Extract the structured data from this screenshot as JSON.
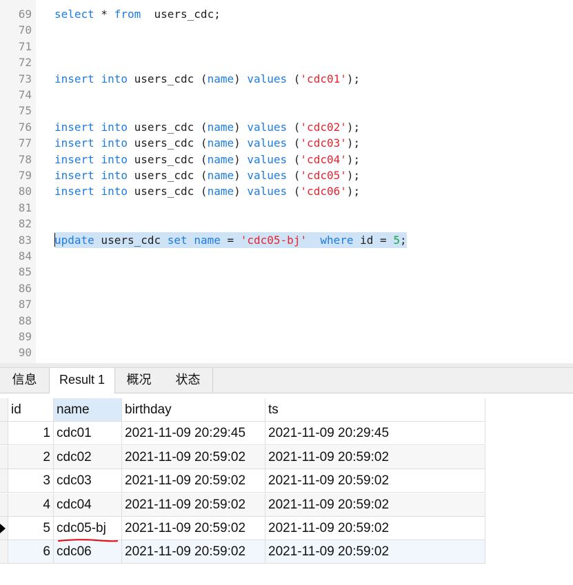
{
  "editor": {
    "lines": [
      {
        "num": "69",
        "tokens": [
          [
            "kw",
            "select"
          ],
          [
            "plain",
            " * "
          ],
          [
            "kw",
            "from"
          ],
          [
            "plain",
            "  users_cdc;"
          ]
        ]
      },
      {
        "num": "70",
        "tokens": []
      },
      {
        "num": "71",
        "tokens": []
      },
      {
        "num": "72",
        "tokens": []
      },
      {
        "num": "73",
        "tokens": [
          [
            "kw",
            "insert"
          ],
          [
            "plain",
            " "
          ],
          [
            "kw",
            "into"
          ],
          [
            "plain",
            " users_cdc ("
          ],
          [
            "kw",
            "name"
          ],
          [
            "plain",
            ") "
          ],
          [
            "kw",
            "values"
          ],
          [
            "plain",
            " ("
          ],
          [
            "str",
            "'cdc01'"
          ],
          [
            "plain",
            ");"
          ]
        ]
      },
      {
        "num": "74",
        "tokens": []
      },
      {
        "num": "75",
        "tokens": []
      },
      {
        "num": "76",
        "tokens": [
          [
            "kw",
            "insert"
          ],
          [
            "plain",
            " "
          ],
          [
            "kw",
            "into"
          ],
          [
            "plain",
            " users_cdc ("
          ],
          [
            "kw",
            "name"
          ],
          [
            "plain",
            ") "
          ],
          [
            "kw",
            "values"
          ],
          [
            "plain",
            " ("
          ],
          [
            "str",
            "'cdc02'"
          ],
          [
            "plain",
            ");"
          ]
        ]
      },
      {
        "num": "77",
        "tokens": [
          [
            "kw",
            "insert"
          ],
          [
            "plain",
            " "
          ],
          [
            "kw",
            "into"
          ],
          [
            "plain",
            " users_cdc ("
          ],
          [
            "kw",
            "name"
          ],
          [
            "plain",
            ") "
          ],
          [
            "kw",
            "values"
          ],
          [
            "plain",
            " ("
          ],
          [
            "str",
            "'cdc03'"
          ],
          [
            "plain",
            ");"
          ]
        ]
      },
      {
        "num": "78",
        "tokens": [
          [
            "kw",
            "insert"
          ],
          [
            "plain",
            " "
          ],
          [
            "kw",
            "into"
          ],
          [
            "plain",
            " users_cdc ("
          ],
          [
            "kw",
            "name"
          ],
          [
            "plain",
            ") "
          ],
          [
            "kw",
            "values"
          ],
          [
            "plain",
            " ("
          ],
          [
            "str",
            "'cdc04'"
          ],
          [
            "plain",
            ");"
          ]
        ]
      },
      {
        "num": "79",
        "tokens": [
          [
            "kw",
            "insert"
          ],
          [
            "plain",
            " "
          ],
          [
            "kw",
            "into"
          ],
          [
            "plain",
            " users_cdc ("
          ],
          [
            "kw",
            "name"
          ],
          [
            "plain",
            ") "
          ],
          [
            "kw",
            "values"
          ],
          [
            "plain",
            " ("
          ],
          [
            "str",
            "'cdc05'"
          ],
          [
            "plain",
            ");"
          ]
        ]
      },
      {
        "num": "80",
        "tokens": [
          [
            "kw",
            "insert"
          ],
          [
            "plain",
            " "
          ],
          [
            "kw",
            "into"
          ],
          [
            "plain",
            " users_cdc ("
          ],
          [
            "kw",
            "name"
          ],
          [
            "plain",
            ") "
          ],
          [
            "kw",
            "values"
          ],
          [
            "plain",
            " ("
          ],
          [
            "str",
            "'cdc06'"
          ],
          [
            "plain",
            ");"
          ]
        ]
      },
      {
        "num": "81",
        "tokens": []
      },
      {
        "num": "82",
        "tokens": []
      },
      {
        "num": "83",
        "selected": true,
        "tokens": [
          [
            "kw",
            "update"
          ],
          [
            "plain",
            " users_cdc "
          ],
          [
            "kw",
            "set"
          ],
          [
            "plain",
            " "
          ],
          [
            "kw",
            "name"
          ],
          [
            "plain",
            " = "
          ],
          [
            "str",
            "'cdc05-bj'"
          ],
          [
            "plain",
            "  "
          ],
          [
            "kw",
            "where"
          ],
          [
            "plain",
            " id = "
          ],
          [
            "num",
            "5"
          ],
          [
            "plain",
            ";"
          ]
        ]
      },
      {
        "num": "84",
        "tokens": []
      },
      {
        "num": "85",
        "tokens": []
      },
      {
        "num": "86",
        "tokens": []
      },
      {
        "num": "87",
        "tokens": []
      },
      {
        "num": "88",
        "tokens": []
      },
      {
        "num": "89",
        "tokens": []
      },
      {
        "num": "90",
        "tokens": []
      }
    ]
  },
  "tabs": [
    {
      "label": "信息",
      "active": false
    },
    {
      "label": "Result 1",
      "active": true
    },
    {
      "label": "概况",
      "active": false
    },
    {
      "label": "状态",
      "active": false
    }
  ],
  "grid": {
    "columns": [
      "id",
      "name",
      "birthday",
      "ts"
    ],
    "sorted_column": "name",
    "rows": [
      {
        "id": "1",
        "name": "cdc01",
        "birthday": "2021-11-09 20:29:45",
        "ts": "2021-11-09 20:29:45"
      },
      {
        "id": "2",
        "name": "cdc02",
        "birthday": "2021-11-09 20:59:02",
        "ts": "2021-11-09 20:59:02"
      },
      {
        "id": "3",
        "name": "cdc03",
        "birthday": "2021-11-09 20:59:02",
        "ts": "2021-11-09 20:59:02"
      },
      {
        "id": "4",
        "name": "cdc04",
        "birthday": "2021-11-09 20:59:02",
        "ts": "2021-11-09 20:59:02"
      },
      {
        "id": "5",
        "name": "cdc05-bj",
        "birthday": "2021-11-09 20:59:02",
        "ts": "2021-11-09 20:59:02",
        "current": true,
        "annotated": true
      },
      {
        "id": "6",
        "name": "cdc06",
        "birthday": "2021-11-09 20:59:02",
        "ts": "2021-11-09 20:59:02",
        "selected": true
      }
    ]
  },
  "colors": {
    "keyword": "#1e7be0",
    "string": "#e8232f",
    "number": "#16a34a",
    "annotation": "#e0141e"
  }
}
